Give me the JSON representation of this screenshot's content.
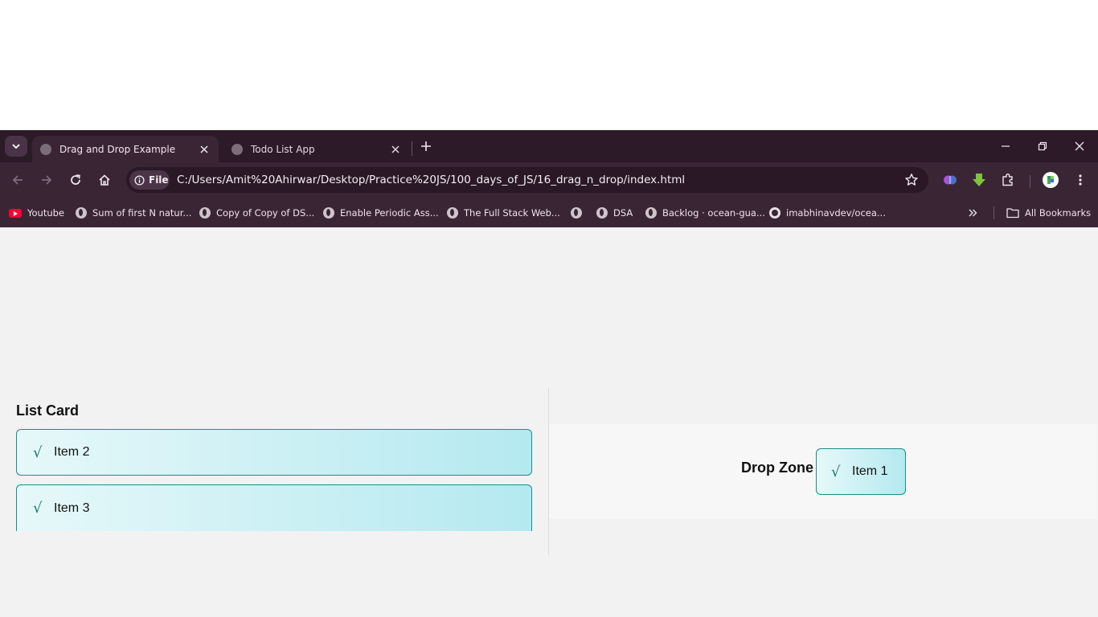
{
  "browser": {
    "tabs": [
      {
        "title": "Drag and Drop Example",
        "active": true
      },
      {
        "title": "Todo List App",
        "active": false
      }
    ],
    "address": {
      "chip_label": "File",
      "url": "C:/Users/Amit%20Ahirwar/Desktop/Practice%20JS/100_days_of_JS/16_drag_n_drop/index.html"
    },
    "bookmarks": [
      {
        "label": "Youtube",
        "icon": "youtube-icon"
      },
      {
        "label": "Sum of first N natur...",
        "icon": "globe-icon"
      },
      {
        "label": "Copy of Copy of DS...",
        "icon": "globe-icon"
      },
      {
        "label": "Enable Periodic Ass...",
        "icon": "globe-icon"
      },
      {
        "label": "The Full Stack Web...",
        "icon": "globe-icon"
      },
      {
        "label": "",
        "icon": "globe-icon"
      },
      {
        "label": "DSA",
        "icon": "globe-icon"
      },
      {
        "label": "Backlog · ocean-gua...",
        "icon": "globe-icon"
      },
      {
        "label": "imabhinavdev/ocea...",
        "icon": "github-icon"
      }
    ],
    "all_bookmarks_label": "All Bookmarks",
    "colors": {
      "frame": "#2c1a28",
      "toolbar": "#3a2535",
      "omnibox": "#2a1827"
    }
  },
  "page": {
    "list_title": "List Card",
    "list_items": [
      {
        "label": "Item 2"
      },
      {
        "label": "Item 3"
      }
    ],
    "drop_zone_title": "Drop Zone",
    "drop_zone_items": [
      {
        "label": "Item 1"
      }
    ],
    "colors": {
      "card_border": "#1a8f86",
      "card_start": "#e6f8f9",
      "card_end": "#b4e9f0",
      "check": "#177a70"
    }
  }
}
